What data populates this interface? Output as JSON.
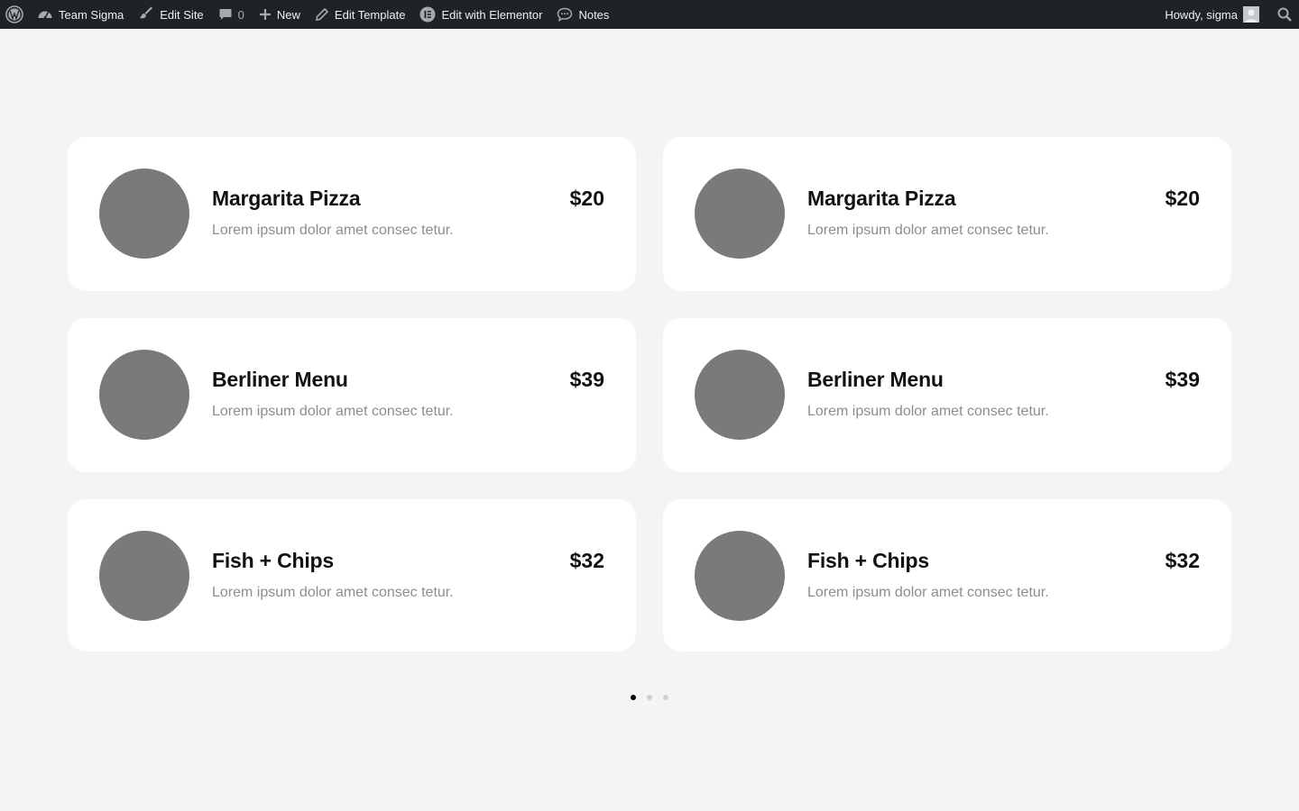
{
  "admin_bar": {
    "site_name": "Team Sigma",
    "edit_site": "Edit Site",
    "comments_count": "0",
    "new": "New",
    "edit_template": "Edit Template",
    "edit_with_elementor": "Edit with Elementor",
    "notes": "Notes",
    "howdy": "Howdy, sigma"
  },
  "menu_items": [
    {
      "name": "Margarita Pizza",
      "price": "$20",
      "description": "Lorem ipsum dolor amet consec tetur."
    },
    {
      "name": "Margarita Pizza",
      "price": "$20",
      "description": "Lorem ipsum dolor amet consec tetur."
    },
    {
      "name": "Berliner Menu",
      "price": "$39",
      "description": "Lorem ipsum dolor amet consec tetur."
    },
    {
      "name": "Berliner Menu",
      "price": "$39",
      "description": "Lorem ipsum dolor amet consec tetur."
    },
    {
      "name": "Fish + Chips",
      "price": "$32",
      "description": "Lorem ipsum dolor amet consec tetur."
    },
    {
      "name": "Fish + Chips",
      "price": "$32",
      "description": "Lorem ipsum dolor amet consec tetur."
    }
  ],
  "pagination": {
    "pages": 3,
    "active_page": 1
  },
  "colors": {
    "admin_bar_bg": "#1d2327",
    "page_bg": "#f4f4f4",
    "card_bg": "#ffffff",
    "thumb_placeholder": "#7a7a7a",
    "description_text": "#8d8d8d",
    "active_dot": "#000000",
    "inactive_dot": "#cfcfcf"
  },
  "icons": [
    "wordpress-logo-icon",
    "dashboard-icon",
    "paintbrush-icon",
    "comment-icon",
    "plus-icon",
    "pencil-icon",
    "elementor-icon",
    "notes-bubble-icon",
    "avatar-icon",
    "search-icon"
  ]
}
